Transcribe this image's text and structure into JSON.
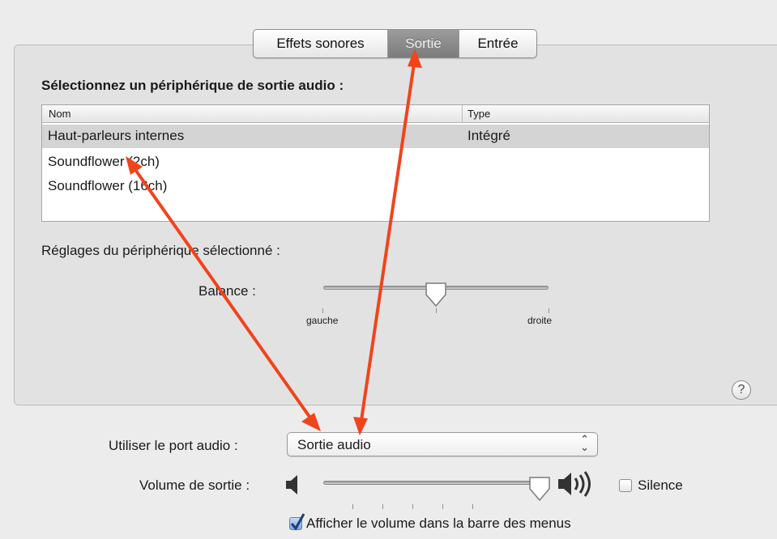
{
  "tabs": [
    {
      "label": "Effets sonores",
      "selected": false
    },
    {
      "label": "Sortie",
      "selected": true
    },
    {
      "label": "Entrée",
      "selected": false
    }
  ],
  "device_section": {
    "title": "Sélectionnez un périphérique de sortie audio :",
    "columns": [
      "Nom",
      "Type"
    ],
    "rows": [
      {
        "name": "Haut-parleurs internes",
        "type": "Intégré",
        "selected": true
      },
      {
        "name": "Soundflower (2ch)",
        "type": "",
        "selected": false
      },
      {
        "name": "Soundflower (16ch)",
        "type": "",
        "selected": false
      }
    ]
  },
  "settings": {
    "title": "Réglages du périphérique sélectionné :",
    "balance_label": "Balance :",
    "balance_left": "gauche",
    "balance_right": "droite",
    "balance_value": 0.5
  },
  "help_label": "?",
  "port": {
    "label": "Utiliser le port audio :",
    "value": "Sortie audio",
    "arrows": "⌃⌄"
  },
  "volume": {
    "label": "Volume de sortie :",
    "value": 0.96,
    "mute_label": "Silence",
    "mute_checked": false
  },
  "menu_volume": {
    "label": "Afficher le volume dans la barre des menus",
    "checked": true
  },
  "colors": {
    "annotation_arrow": "#f0441c",
    "tab_selected": "#8a8a8a",
    "row_selected": "#d4d4d4"
  }
}
